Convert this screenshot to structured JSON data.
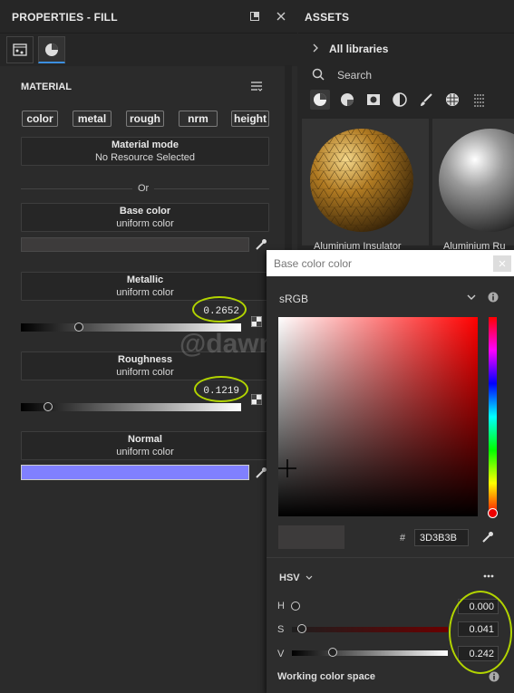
{
  "properties": {
    "title": "PROPERTIES - FILL",
    "section_title": "MATERIAL",
    "channels": [
      "color",
      "metal",
      "rough",
      "nrm",
      "height"
    ],
    "material_mode": {
      "label": "Material mode",
      "value": "No Resource Selected"
    },
    "or_label": "Or",
    "base_color": {
      "label": "Base color",
      "mode": "uniform color",
      "swatch": "#3D3B3B"
    },
    "metallic": {
      "label": "Metallic",
      "mode": "uniform color",
      "value": "0.2652",
      "level": 0.2652
    },
    "roughness": {
      "label": "Roughness",
      "mode": "uniform color",
      "value": "0.1219",
      "level": 0.1219
    },
    "normal": {
      "label": "Normal",
      "mode": "uniform color",
      "swatch": "#8080FF"
    }
  },
  "assets": {
    "title": "ASSETS",
    "library": "All libraries",
    "search_placeholder": "Search",
    "thumbnails": [
      "Aluminium Insulator",
      "Aluminium Ru"
    ]
  },
  "watermark": "@dawn_arc",
  "color_dialog": {
    "title": "Base color color",
    "color_space": "sRGB",
    "hex_label": "#",
    "hex_value": "3D3B3B",
    "model": "HSV",
    "h_label": "H",
    "h_value": "0.000",
    "h_level": 0.0,
    "s_label": "S",
    "s_value": "0.041",
    "s_level": 0.041,
    "v_label": "V",
    "v_value": "0.242",
    "v_level": 0.242,
    "working_space_label": "Working color space"
  },
  "colors": {
    "accent": "#b2d400",
    "tab_highlight": "#3c8fe0"
  }
}
